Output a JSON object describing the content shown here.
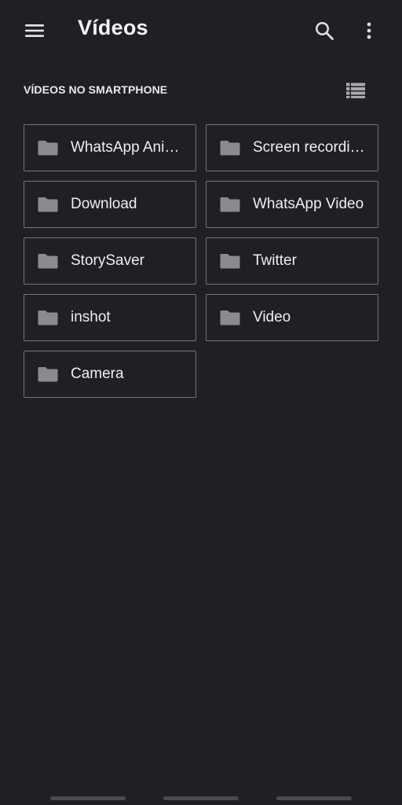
{
  "app_bar": {
    "title": "Vídeos",
    "menu_icon": "hamburger-menu-icon",
    "search_icon": "search-icon",
    "more_icon": "more-vert-icon"
  },
  "section": {
    "header": "VÍDEOS NO SMARTPHONE",
    "view_toggle_icon": "list-view-icon"
  },
  "folders": [
    {
      "name": "WhatsApp Ani…"
    },
    {
      "name": "Screen recordin…"
    },
    {
      "name": "Download"
    },
    {
      "name": "WhatsApp Video"
    },
    {
      "name": "StorySaver"
    },
    {
      "name": "Twitter"
    },
    {
      "name": "inshot"
    },
    {
      "name": "Video"
    },
    {
      "name": "Camera"
    }
  ],
  "colors": {
    "background": "#1f2023",
    "card_border": "#74767b",
    "folder_icon": "#8a8b8f",
    "text": "#efefef"
  }
}
